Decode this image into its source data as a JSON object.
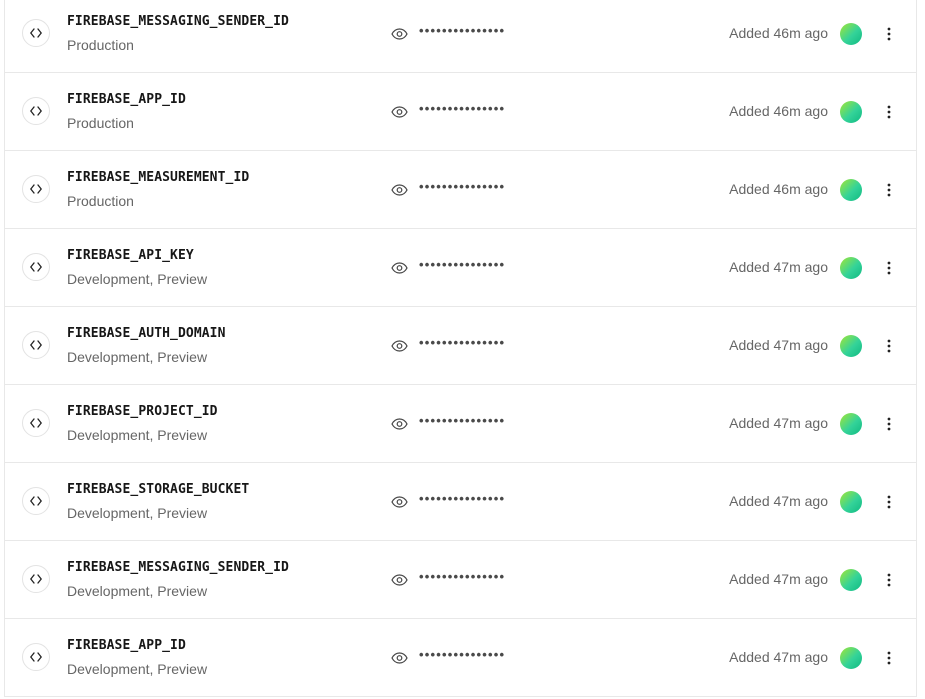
{
  "variables": [
    {
      "name": "FIREBASE_MESSAGING_SENDER_ID",
      "environments": "Production",
      "masked_value": "•••••••••••••••",
      "added": "Added 46m ago"
    },
    {
      "name": "FIREBASE_APP_ID",
      "environments": "Production",
      "masked_value": "•••••••••••••••",
      "added": "Added 46m ago"
    },
    {
      "name": "FIREBASE_MEASUREMENT_ID",
      "environments": "Production",
      "masked_value": "•••••••••••••••",
      "added": "Added 46m ago"
    },
    {
      "name": "FIREBASE_API_KEY",
      "environments": "Development, Preview",
      "masked_value": "•••••••••••••••",
      "added": "Added 47m ago"
    },
    {
      "name": "FIREBASE_AUTH_DOMAIN",
      "environments": "Development, Preview",
      "masked_value": "•••••••••••••••",
      "added": "Added 47m ago"
    },
    {
      "name": "FIREBASE_PROJECT_ID",
      "environments": "Development, Preview",
      "masked_value": "•••••••••••••••",
      "added": "Added 47m ago"
    },
    {
      "name": "FIREBASE_STORAGE_BUCKET",
      "environments": "Development, Preview",
      "masked_value": "•••••••••••••••",
      "added": "Added 47m ago"
    },
    {
      "name": "FIREBASE_MESSAGING_SENDER_ID",
      "environments": "Development, Preview",
      "masked_value": "•••••••••••••••",
      "added": "Added 47m ago"
    },
    {
      "name": "FIREBASE_APP_ID",
      "environments": "Development, Preview",
      "masked_value": "•••••••••••••••",
      "added": "Added 47m ago"
    }
  ],
  "icons": {
    "row_type": "code-brackets-icon",
    "reveal": "eye-icon",
    "menu": "more-vertical-icon"
  },
  "colors": {
    "avatar_gradient_start": "#a3e635",
    "avatar_gradient_end": "#10b981"
  }
}
